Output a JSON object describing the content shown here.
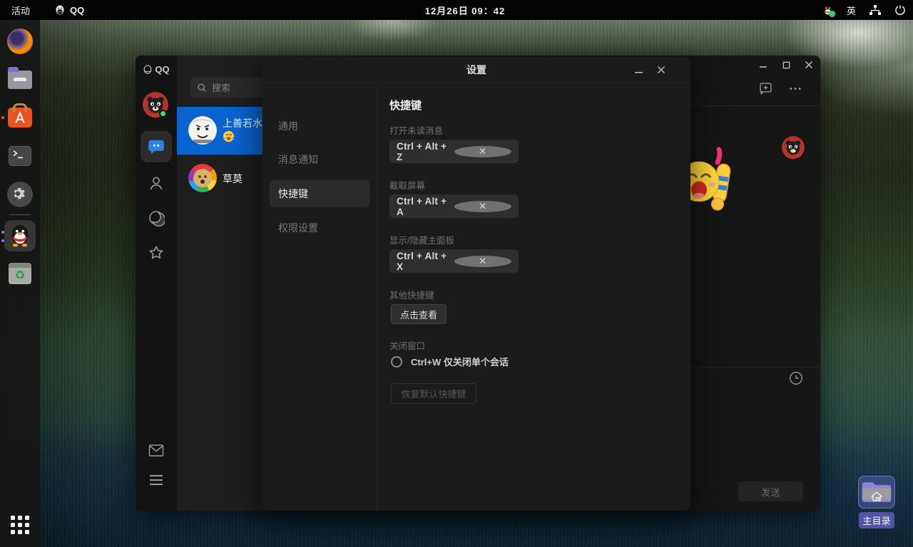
{
  "topbar": {
    "activities": "活动",
    "focused_app": "QQ",
    "clock": "12月26日 09：42",
    "input_method": "英"
  },
  "qq": {
    "logo_text": "QQ",
    "search_placeholder": "搜索",
    "chats": [
      {
        "name": "上善若水"
      },
      {
        "name": "草莫"
      }
    ],
    "send_label": "发送"
  },
  "settings": {
    "title": "设置",
    "nav": [
      {
        "label": "通用"
      },
      {
        "label": "消息通知"
      },
      {
        "label": "快捷键"
      },
      {
        "label": "权限设置"
      }
    ],
    "heading": "快捷键",
    "shortcuts": [
      {
        "label": "打开未读消息",
        "value": "Ctrl + Alt + Z"
      },
      {
        "label": "截取屏幕",
        "value": "Ctrl + Alt + A"
      },
      {
        "label": "显示/隐藏主面板",
        "value": "Ctrl + Alt + X"
      }
    ],
    "other_shortcuts_label": "其他快捷键",
    "view_button": "点击查看",
    "close_window_label": "关闭窗口",
    "close_window_option": "Ctrl+W 仅关闭单个会话",
    "restore_button": "恢复默认快捷键"
  },
  "desktop": {
    "home_folder_label": "主目录"
  },
  "colors": {
    "selection_blue": "#0a64d0",
    "chat_bubble_blue": "#2a82e4",
    "ubuntu_orange": "#e95420"
  }
}
